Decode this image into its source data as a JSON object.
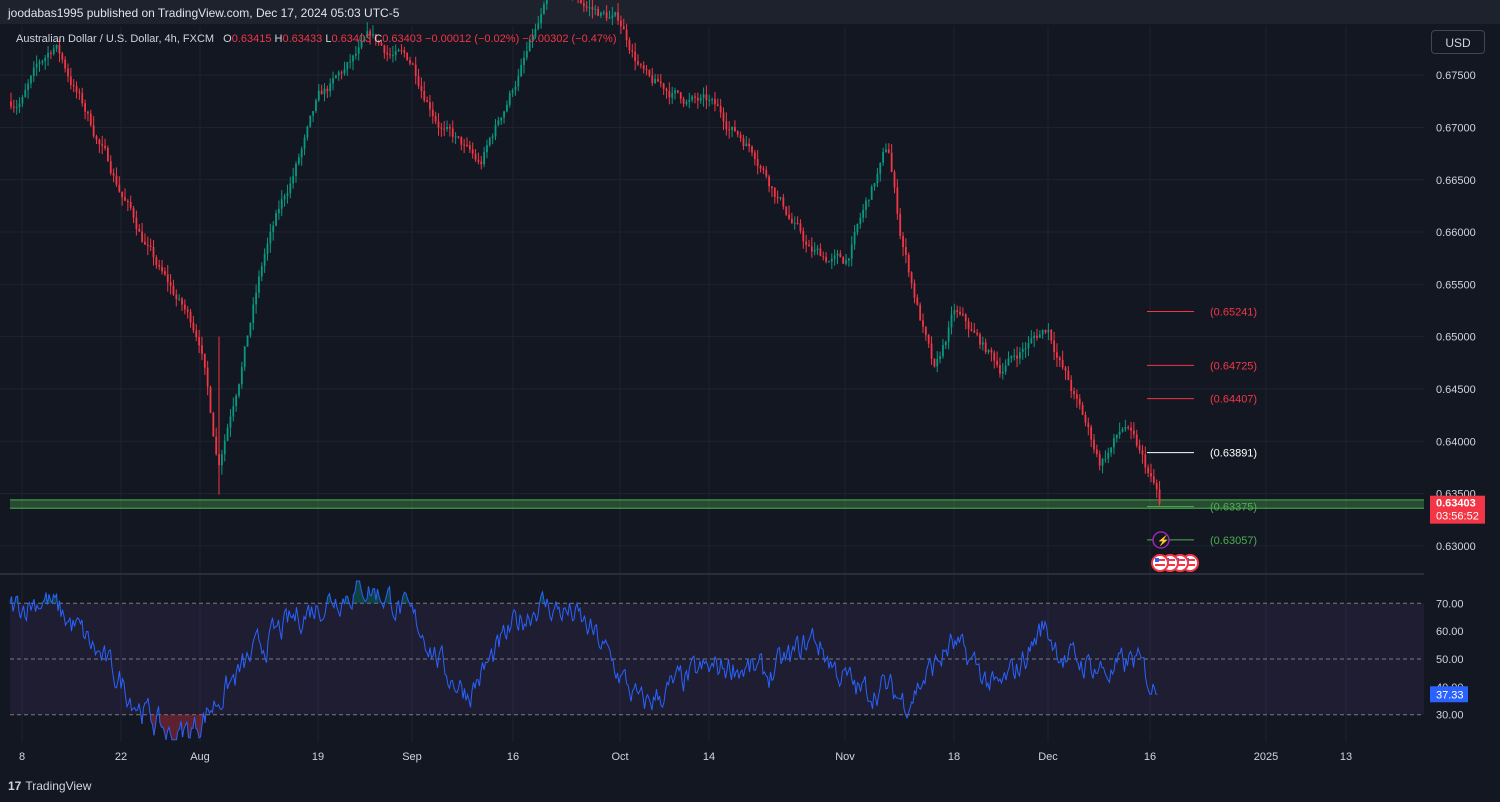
{
  "header": {
    "published": "joodabas1995 published on TradingView.com, Dec 17, 2024 05:03 UTC-5"
  },
  "legend": {
    "symbol": "Australian Dollar / U.S. Dollar, 4h, FXCM",
    "open_label": "O",
    "open": "0.63415",
    "high_label": "H",
    "high": "0.63433",
    "low_label": "L",
    "low": "0.63403",
    "close_label": "C",
    "close": "0.63403",
    "change": "−0.00012 (−0.02%)",
    "change_extra": "−0.00302 (−0.47%)"
  },
  "currency_button": "USD",
  "footer": {
    "brand": "TradingView"
  },
  "colors": {
    "background": "#131722",
    "up": "#089981",
    "down": "#f23645",
    "rsi": "#2962ff",
    "support": "#4caf50"
  },
  "chart_data": {
    "type": "candlestick",
    "symbol": "AUDUSD",
    "interval": "4h",
    "y_ticks": [
      "0.67500",
      "0.67000",
      "0.66500",
      "0.66000",
      "0.65500",
      "0.65000",
      "0.64500",
      "0.64000",
      "0.63500",
      "0.63000"
    ],
    "ylim": [
      0.6275,
      0.6797
    ],
    "x_ticks": [
      "8",
      "22",
      "Aug",
      "19",
      "Sep",
      "16",
      "Oct",
      "14",
      "Nov",
      "18",
      "Dec",
      "16",
      "2025",
      "13"
    ],
    "price_path_anchors": [
      [
        "8",
        0.673
      ],
      [
        "Jul 12",
        0.678
      ],
      [
        "22",
        0.664
      ],
      [
        "Jul 26",
        0.656
      ],
      [
        "Aug",
        0.65
      ],
      [
        "Aug 5",
        0.638
      ],
      [
        "Aug 12",
        0.658
      ],
      [
        "19",
        0.672
      ],
      [
        "Aug 26",
        0.678
      ],
      [
        "Sep",
        0.676
      ],
      [
        "Sep 6",
        0.67
      ],
      [
        "Sep 11",
        0.666
      ],
      [
        "16",
        0.674
      ],
      [
        "Sep 23",
        0.683
      ],
      [
        "Oct",
        0.68
      ],
      [
        "Oct 4",
        0.674
      ],
      [
        "14",
        0.672
      ],
      [
        "Oct 22",
        0.668
      ],
      [
        "Oct 29",
        0.658
      ],
      [
        "Nov",
        0.657
      ],
      [
        "Nov 6",
        0.668
      ],
      [
        "Nov 8",
        0.66
      ],
      [
        "Nov 14",
        0.646
      ],
      [
        "18",
        0.652
      ],
      [
        "Nov 25",
        0.647
      ],
      [
        "Dec",
        0.651
      ],
      [
        "Dec 5",
        0.644
      ],
      [
        "Dec 10",
        0.638
      ],
      [
        "Dec 12",
        0.6415
      ],
      [
        "16",
        0.6341
      ]
    ],
    "support_zone": [
      0.6336,
      0.6344
    ],
    "levels": [
      {
        "label": "(0.65241)",
        "value": 0.65241,
        "color": "#f23645"
      },
      {
        "label": "(0.64725)",
        "value": 0.64725,
        "color": "#f23645"
      },
      {
        "label": "(0.64407)",
        "value": 0.64407,
        "color": "#f23645"
      },
      {
        "label": "(0.63891)",
        "value": 0.63891,
        "color": "#ffffff"
      },
      {
        "label": "(0.63375)",
        "value": 0.63375,
        "color": "#4caf50"
      },
      {
        "label": "(0.63057)",
        "value": 0.63057,
        "color": "#4caf50"
      }
    ],
    "last_price": "0.63403",
    "countdown": "03:56:52",
    "rsi": {
      "y_ticks": [
        "70.00",
        "60.00",
        "50.00",
        "40.00",
        "30.00"
      ],
      "ylim": [
        20.2,
        79.8
      ],
      "band": [
        30,
        70
      ],
      "last_value": "37.33",
      "path_anchors": [
        [
          0,
          68
        ],
        [
          3,
          72
        ],
        [
          6,
          60
        ],
        [
          9,
          45
        ],
        [
          12,
          30
        ],
        [
          14,
          22
        ],
        [
          16,
          25
        ],
        [
          18,
          35
        ],
        [
          20,
          45
        ],
        [
          22,
          55
        ],
        [
          25,
          65
        ],
        [
          28,
          72
        ],
        [
          31,
          76
        ],
        [
          33,
          72
        ],
        [
          36,
          60
        ],
        [
          38,
          45
        ],
        [
          40,
          38
        ],
        [
          42,
          50
        ],
        [
          44,
          62
        ],
        [
          46,
          70
        ],
        [
          49,
          66
        ],
        [
          51,
          58
        ],
        [
          53,
          45
        ],
        [
          55,
          33
        ],
        [
          57,
          38
        ],
        [
          60,
          45
        ],
        [
          63,
          48
        ],
        [
          66,
          44
        ],
        [
          68,
          50
        ],
        [
          70,
          58
        ],
        [
          72,
          46
        ],
        [
          74,
          38
        ],
        [
          76,
          40
        ],
        [
          78,
          35
        ],
        [
          80,
          45
        ],
        [
          82,
          55
        ],
        [
          84,
          48
        ],
        [
          86,
          38
        ],
        [
          88,
          48
        ],
        [
          90,
          62
        ],
        [
          92,
          50
        ],
        [
          94,
          48
        ],
        [
          96,
          45
        ],
        [
          98,
          50
        ],
        [
          100,
          37
        ]
      ]
    }
  }
}
